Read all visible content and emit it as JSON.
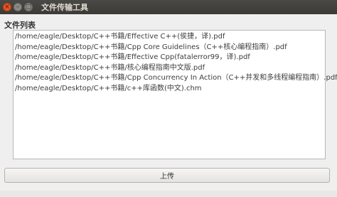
{
  "window": {
    "title": "文件传输工具",
    "buttons": {
      "close": "×",
      "minimize": "–",
      "maximize": "□"
    }
  },
  "file_list": {
    "label": "文件列表",
    "items": [
      "/home/eagle/Desktop/C++书籍/Effective C++(侯捷，译).pdf",
      "/home/eagle/Desktop/C++书籍/Cpp Core Guidelines（C++核心编程指南）.pdf",
      "/home/eagle/Desktop/C++书籍/Effective Cpp(fatalerror99，译).pdf",
      "/home/eagle/Desktop/C++书籍/核心编程指南中文版.pdf",
      "/home/eagle/Desktop/C++书籍/Cpp Concurrency In Action（C++并发和多线程编程指南）.pdf",
      "/home/eagle/Desktop/C++书籍/c++库函数(中文).chm"
    ]
  },
  "upload_button": {
    "label": "上传"
  },
  "colors": {
    "titlebar": "#3b3a36",
    "close": "#e95420",
    "window_bg": "#efefef"
  }
}
